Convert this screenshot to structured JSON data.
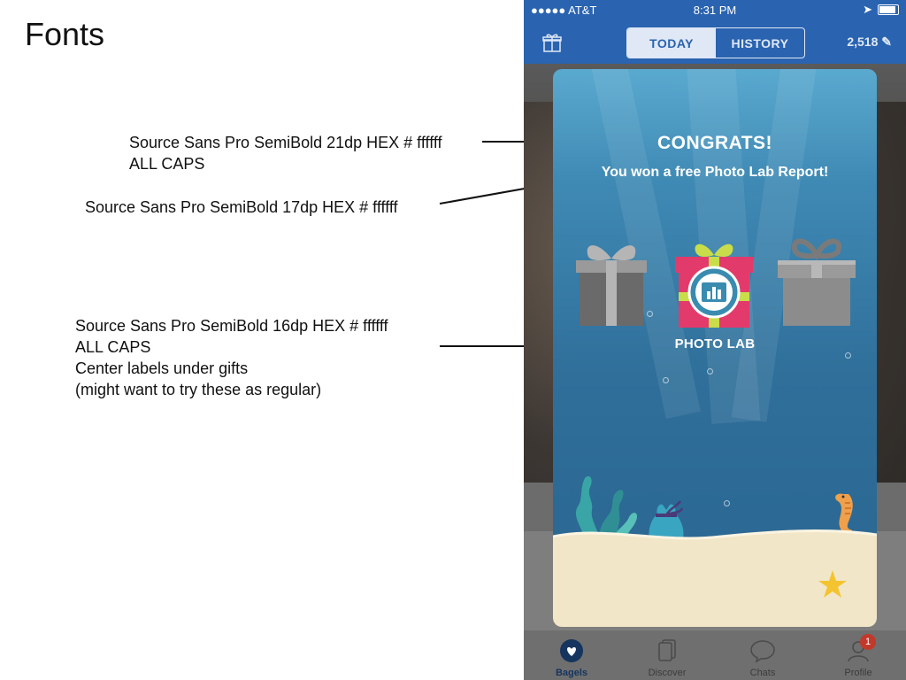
{
  "slide": {
    "title": "Fonts",
    "notes": [
      "Source Sans Pro SemiBold 21dp HEX # ffffff\nALL CAPS",
      "Source Sans Pro SemiBold 17dp HEX # ffffff",
      "Source Sans Pro SemiBold 16dp HEX # ffffff\nALL CAPS\nCenter labels under gifts\n(might want to try these as regular)"
    ]
  },
  "status_bar": {
    "carrier": "●●●●● AT&T",
    "time": "8:31 PM"
  },
  "nav": {
    "tabs": [
      "TODAY",
      "HISTORY"
    ],
    "active_tab": "TODAY",
    "points": "2,518"
  },
  "modal": {
    "title": "CONGRATS!",
    "subtitle": "You won a free Photo Lab Report!",
    "gift_label": "PHOTO LAB"
  },
  "tabbar": {
    "items": [
      "Bagels",
      "Discover",
      "Chats",
      "Profile"
    ],
    "active": "Bagels",
    "profile_badge": "1"
  },
  "colors": {
    "nav_blue": "#2a64b0",
    "modal_text": "#ffffff",
    "gift_pink": "#e23b6b",
    "ribbon_yellow": "#c9dd4a",
    "badge_red": "#c0392b"
  }
}
